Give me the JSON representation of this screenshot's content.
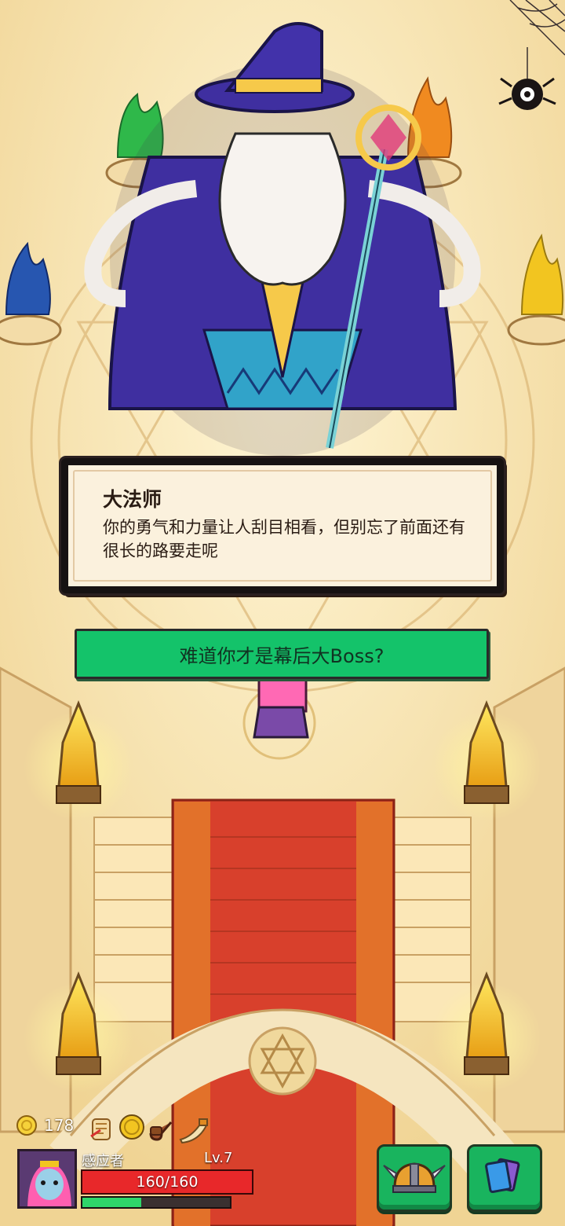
{
  "dialog": {
    "speaker": "大法师",
    "text": "你的勇气和力量让人刮目相看，但别忘了前面还有很长的路要走呢"
  },
  "choices": [
    {
      "label": "难道你才是幕后大Boss?"
    }
  ],
  "player": {
    "coins": "178",
    "name": "感应者",
    "level": "Lv.7",
    "hp_text": "160/160",
    "hp_fraction": 1.0,
    "xp_fraction": 0.4
  },
  "inventory": [
    "scroll-icon",
    "gold-coin-icon",
    "pipe-icon",
    "horn-icon"
  ],
  "buttons": [
    "helmet-button",
    "cards-button"
  ],
  "colors": {
    "choice": "#14c36a",
    "hp": "#e8282a",
    "xp": "#2fd66a",
    "carpet": "#d8402c"
  }
}
